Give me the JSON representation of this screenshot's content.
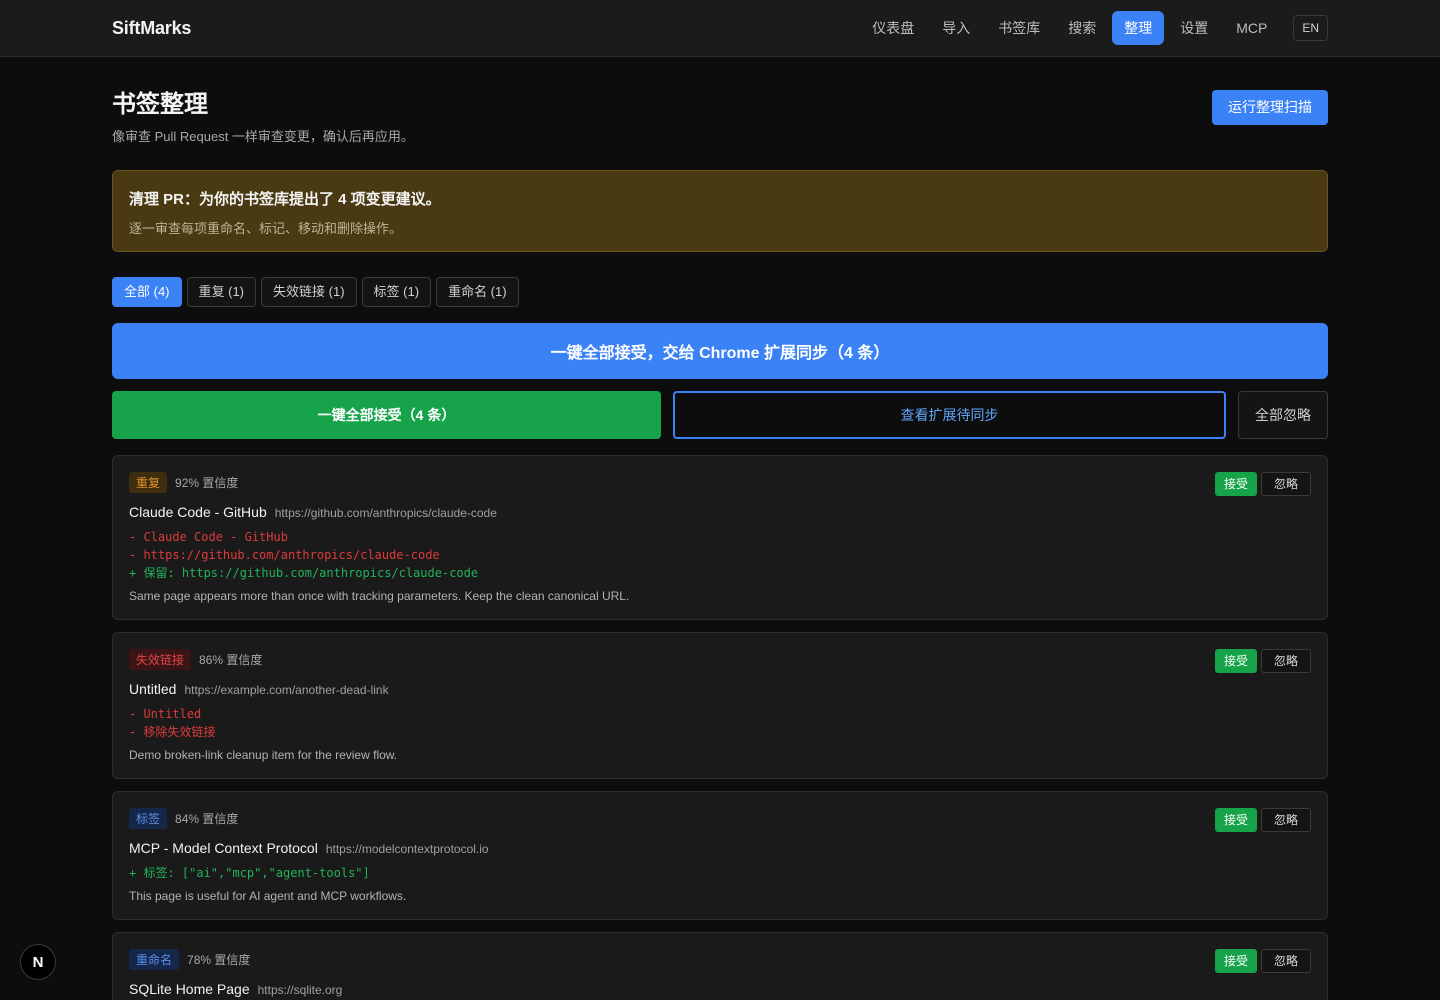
{
  "header": {
    "brand": "SiftMarks",
    "nav": [
      "仪表盘",
      "导入",
      "书签库",
      "搜索",
      "整理",
      "设置",
      "MCP"
    ],
    "active_nav": "整理",
    "lang": "EN"
  },
  "page": {
    "title": "书签整理",
    "subtitle": "像审查 Pull Request 一样审查变更，确认后再应用。",
    "run_button": "运行整理扫描"
  },
  "notice": {
    "title": "清理 PR：为你的书签库提出了 4 项变更建议。",
    "subtitle": "逐一审查每项重命名、标记、移动和删除操作。"
  },
  "filters": [
    "全部 (4)",
    "重复 (1)",
    "失效链接 (1)",
    "标签 (1)",
    "重命名 (1)"
  ],
  "actions": {
    "accept_all_sync": "一键全部接受，交给 Chrome 扩展同步（4 条）",
    "accept_all": "一键全部接受（4 条）",
    "view_sync": "查看扩展待同步",
    "ignore_all": "全部忽略"
  },
  "card_buttons": {
    "accept": "接受",
    "ignore": "忽略"
  },
  "cards": [
    {
      "type": "重复",
      "confidence": "92% 置信度",
      "title": "Claude Code - GitHub",
      "url": "https://github.com/anthropics/claude-code",
      "diff_minus": [
        "- Claude Code - GitHub",
        "- https://github.com/anthropics/claude-code"
      ],
      "diff_plus": [
        "+ 保留: https://github.com/anthropics/claude-code"
      ],
      "note": "Same page appears more than once with tracking parameters. Keep the clean canonical URL."
    },
    {
      "type": "失效链接",
      "confidence": "86% 置信度",
      "title": "Untitled",
      "url": "https://example.com/another-dead-link",
      "diff_minus": [
        "- Untitled",
        "- 移除失效链接"
      ],
      "diff_plus": [],
      "note": "Demo broken-link cleanup item for the review flow."
    },
    {
      "type": "标签",
      "confidence": "84% 置信度",
      "title": "MCP - Model Context Protocol",
      "url": "https://modelcontextprotocol.io",
      "diff_minus": [],
      "diff_plus": [
        "+ 标签: [\"ai\",\"mcp\",\"agent-tools\"]"
      ],
      "note": "This page is useful for AI agent and MCP workflows."
    },
    {
      "type": "重命名",
      "confidence": "78% 置信度",
      "title": "SQLite Home Page",
      "url": "https://sqlite.org",
      "diff_minus": [],
      "diff_plus": [],
      "note": ""
    }
  ],
  "dev_badge": "N"
}
